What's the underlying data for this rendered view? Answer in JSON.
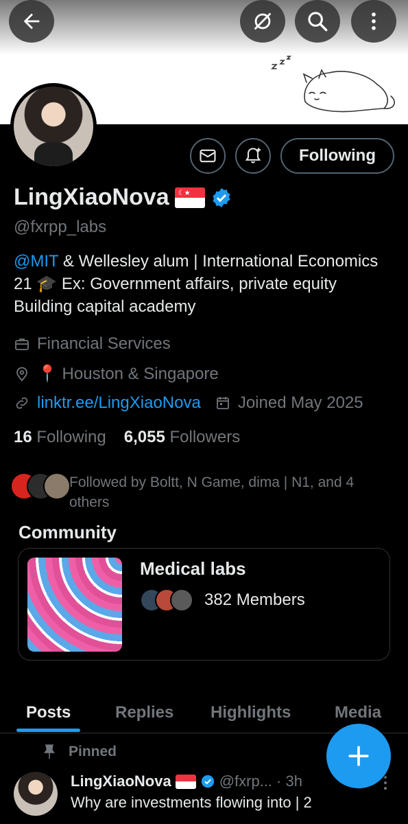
{
  "profile": {
    "name": "LingXiaoNova",
    "handle": "@fxrpp_labs",
    "bio_mention": "@MIT",
    "bio_text": " & Wellesley alum | International Economics 21 🎓 Ex: Government affairs, private equity Building capital academy",
    "category": "Financial Services",
    "location": "📍 Houston & Singapore",
    "website": "linktr.ee/LingXiaoNova",
    "joined": "Joined May 2025"
  },
  "actions": {
    "following_label": "Following"
  },
  "stats": {
    "following_count": "16",
    "following_label": "Following",
    "followers_count": "6,055",
    "followers_label": "Followers"
  },
  "followed_by": "Followed by Boltt, N Game, dima | N1, and 4 others",
  "community": {
    "section_title": "Community",
    "name": "Medical labs",
    "members": "382 Members"
  },
  "tabs": [
    "Posts",
    "Replies",
    "Highlights",
    "Media"
  ],
  "active_tab": "Posts",
  "pinned_label": "Pinned",
  "post": {
    "name": "LingXiaoNova",
    "handle": "@fxrp...",
    "time": "· 3h",
    "text": "Why are investments flowing into | 2"
  },
  "colors": {
    "accent": "#1d9bf0",
    "background": "#000000",
    "muted": "#71767b"
  },
  "icons": [
    "back-arrow-icon",
    "hide-icon",
    "search-icon",
    "more-vertical-icon",
    "mail-icon",
    "notification-bell-icon",
    "briefcase-icon",
    "location-icon",
    "link-icon",
    "calendar-icon",
    "pin-icon",
    "compose-plus-icon",
    "verified-badge-icon"
  ]
}
